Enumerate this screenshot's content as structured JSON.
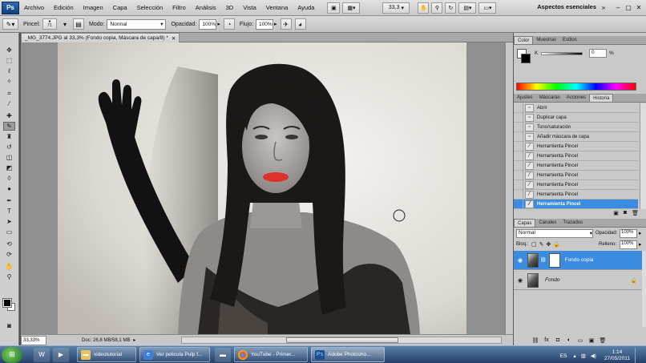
{
  "menubar": {
    "app_icon": "Ps",
    "items": [
      "Archivo",
      "Edición",
      "Imagen",
      "Capa",
      "Selección",
      "Filtro",
      "Análisis",
      "3D",
      "Vista",
      "Ventana",
      "Ayuda"
    ],
    "zoom": "33,3",
    "workspace": "Aspectos esenciales"
  },
  "options": {
    "brush_label": "Pincel:",
    "brush_size": "71",
    "mode_label": "Modo:",
    "mode_value": "Normal",
    "opacity_label": "Opacidad:",
    "opacity_value": "100%",
    "flow_label": "Flujo:",
    "flow_value": "100%"
  },
  "document": {
    "tab_title": "_MG_3774.JPG al 33,3% (Fondo copia, Máscara de capa/8) *",
    "zoom": "33,33%",
    "doc_info": "Doc: 26,8 MB/58,1 MB"
  },
  "color_panel": {
    "tabs": [
      "Color",
      "Muestras",
      "Estilos"
    ],
    "channel": "K",
    "value": "0",
    "unit": "%"
  },
  "history_panel": {
    "tabs": [
      "Ajustes",
      "Máscaras",
      "Acciones",
      "Historia"
    ],
    "items": [
      {
        "label": "Abrir"
      },
      {
        "label": "Duplicar capa"
      },
      {
        "label": "Tono/saturación"
      },
      {
        "label": "Añadir máscara de capa"
      },
      {
        "label": "Herramienta Pincel"
      },
      {
        "label": "Herramienta Pincel"
      },
      {
        "label": "Herramienta Pincel"
      },
      {
        "label": "Herramienta Pincel"
      },
      {
        "label": "Herramienta Pincel"
      },
      {
        "label": "Herramienta Pincel"
      },
      {
        "label": "Herramienta Pincel"
      }
    ]
  },
  "layers_panel": {
    "tabs": [
      "Capas",
      "Canales",
      "Trazados"
    ],
    "blend_mode": "Normal",
    "opacity_label": "Opacidad:",
    "opacity_value": "100%",
    "lock_label": "Bloq.:",
    "fill_label": "Relleno:",
    "fill_value": "100%",
    "layers": [
      {
        "name": "Fondo copia",
        "selected": true
      },
      {
        "name": "Fondo",
        "selected": false
      }
    ]
  },
  "taskbar": {
    "tasks": [
      {
        "label": "videotutorial",
        "icon": "folder-icon"
      },
      {
        "label": "Ver pelicula Pulp f...",
        "icon": "ie-icon"
      },
      {
        "label": "YouTube - Primer...",
        "icon": "chrome-icon"
      },
      {
        "label": "Adobe Photosho...",
        "icon": "photoshop-icon"
      }
    ],
    "lang": "ES",
    "time": "1:14",
    "date": "27/05/2011"
  },
  "colors": {
    "selection_blue": "#3b8be0",
    "lips_red": "#e0302b"
  }
}
